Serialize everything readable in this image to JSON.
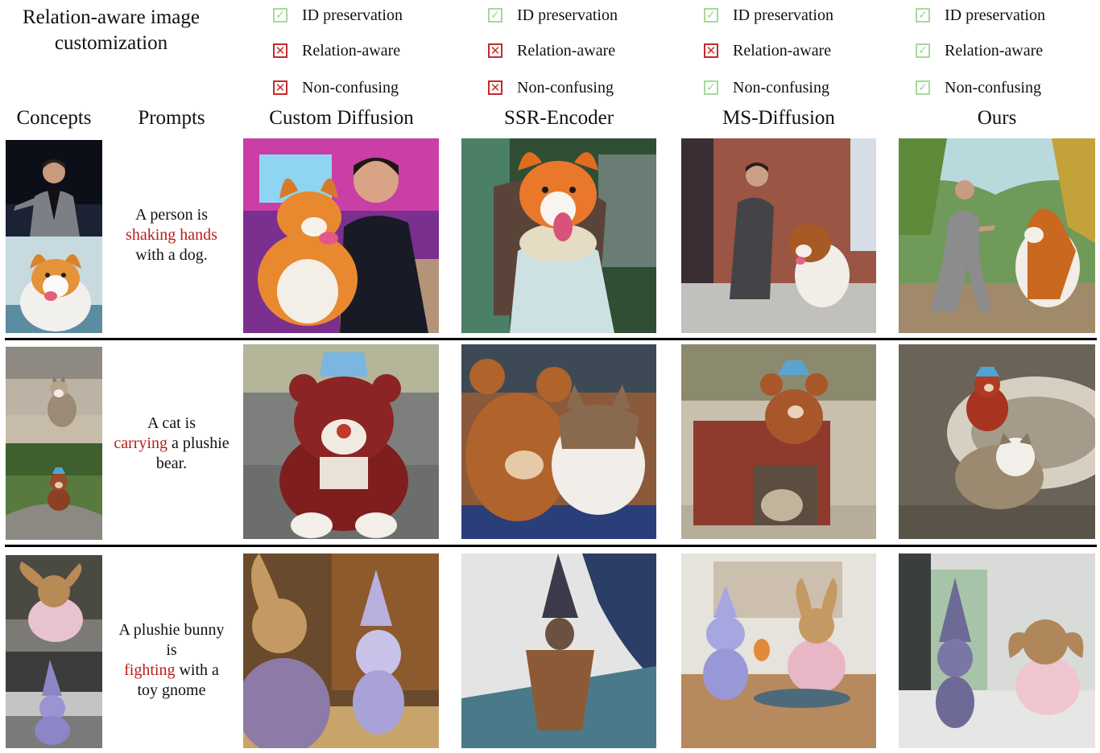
{
  "title": "Relation-aware image customization",
  "criteria_columns": [
    {
      "items": [
        {
          "label": "ID preservation",
          "status": "check"
        },
        {
          "label": "Relation-aware",
          "status": "cross"
        },
        {
          "label": "Non-confusing",
          "status": "cross"
        }
      ]
    },
    {
      "items": [
        {
          "label": "ID preservation",
          "status": "check"
        },
        {
          "label": "Relation-aware",
          "status": "cross"
        },
        {
          "label": "Non-confusing",
          "status": "cross"
        }
      ]
    },
    {
      "items": [
        {
          "label": "ID preservation",
          "status": "check"
        },
        {
          "label": "Relation-aware",
          "status": "cross"
        },
        {
          "label": "Non-confusing",
          "status": "check"
        }
      ]
    },
    {
      "items": [
        {
          "label": "ID preservation",
          "status": "check"
        },
        {
          "label": "Relation-aware",
          "status": "check"
        },
        {
          "label": "Non-confusing",
          "status": "check"
        }
      ]
    }
  ],
  "columns": {
    "concepts": "Concepts",
    "prompts": "Prompts",
    "custom_diffusion": "Custom Diffusion",
    "ssr_encoder": "SSR-Encoder",
    "ms_diffusion": "MS-Diffusion",
    "ours": "Ours"
  },
  "rows": [
    {
      "prompt": {
        "before": "A person is",
        "highlight": "shaking hands",
        "after": "with a dog."
      },
      "concept_images": [
        "man-in-grey-blazer",
        "corgi-dog"
      ],
      "result_images": [
        "man-with-corgi-on-sofa",
        "corgi-in-jacket",
        "man-dancing-with-dog",
        "man-shaking-paw-of-dog"
      ]
    },
    {
      "prompt": {
        "before": "A cat is",
        "highlight": "carrying",
        "after": "a plushie bear."
      },
      "concept_images": [
        "tabby-cat",
        "teddy-bear-on-rock"
      ],
      "result_images": [
        "red-teddy-bear",
        "teddy-bear-with-cat",
        "bear-on-brick-box-with-cat",
        "cat-carrying-bear"
      ]
    },
    {
      "prompt": {
        "before": "A plushie bunny is",
        "highlight": "fighting",
        "after": "with a toy gnome"
      },
      "concept_images": [
        "plush-bunny",
        "purple-gnome-figurine"
      ],
      "result_images": [
        "bunny-and-purple-gnome",
        "gnome-in-brown-coat",
        "gnome-and-bunny-on-table",
        "gnome-and-bunny-by-window"
      ]
    }
  ],
  "colors": {
    "highlight": "#b81d1d",
    "check": "#9bd38a",
    "cross": "#c42a2a"
  }
}
